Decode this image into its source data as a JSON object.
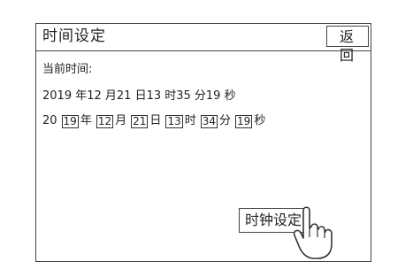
{
  "header": {
    "title": "时间设定",
    "back_label": "返回"
  },
  "current": {
    "label": "当前时间:",
    "value": "2019 年12 月21 日13 时35 分19 秒"
  },
  "input": {
    "prefix": "20",
    "year": "19",
    "year_unit": "年",
    "month": "12",
    "month_unit": "月",
    "day": "21",
    "day_unit": "日",
    "hour": "13",
    "hour_unit": "时",
    "minute": "34",
    "minute_unit": "分",
    "second": "19",
    "second_unit": "秒"
  },
  "footer": {
    "set_label": "时钟设定"
  },
  "icons": {
    "pointer": "hand-pointer-icon"
  }
}
